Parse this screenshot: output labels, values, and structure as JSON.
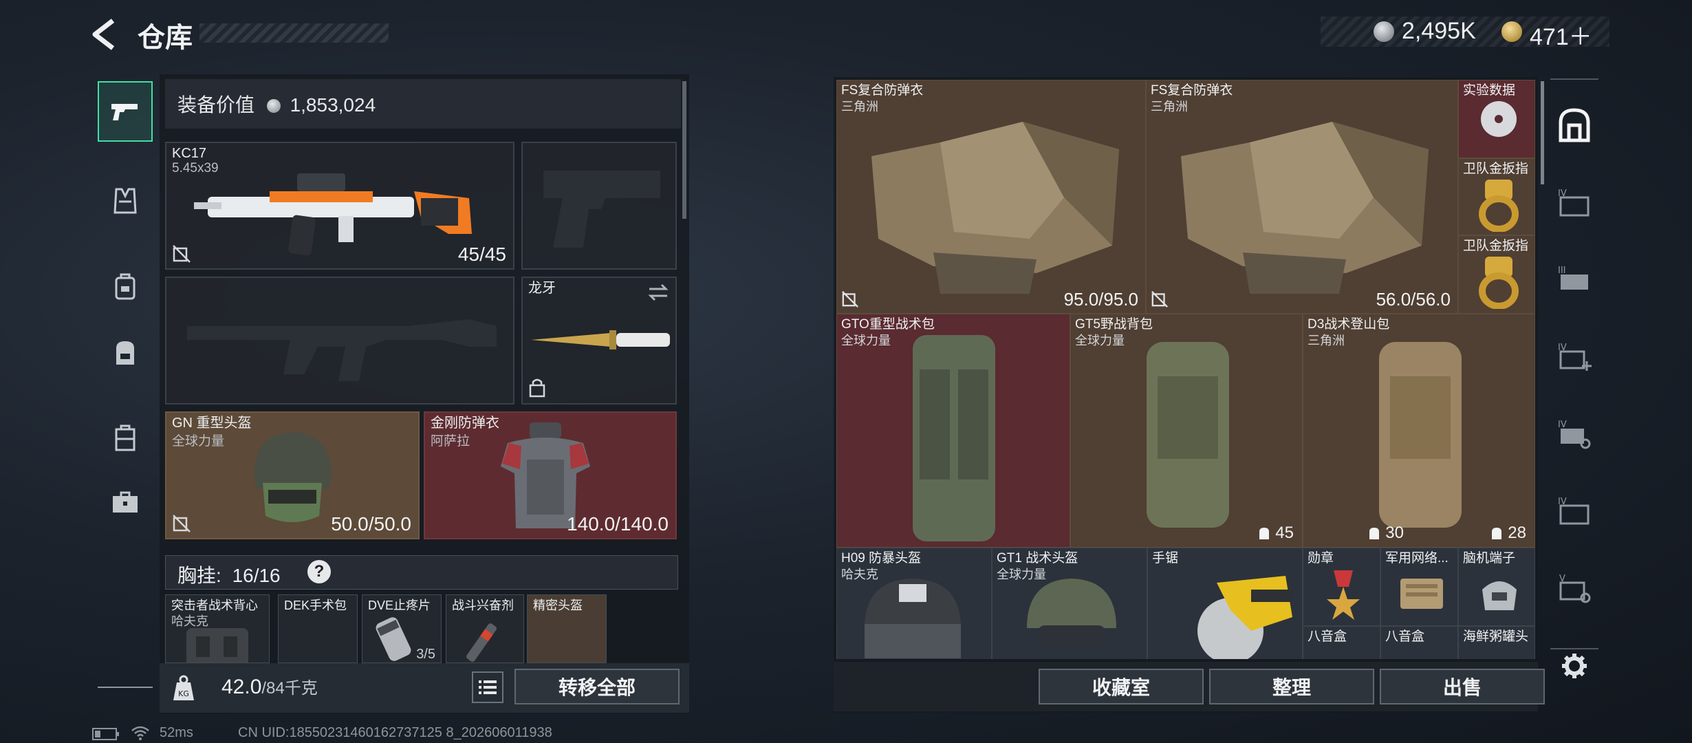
{
  "header": {
    "title": "仓库",
    "silver_amount": "2,495K",
    "gold_amount": "471＋"
  },
  "left_rail": {
    "items": [
      {
        "icon": "pistol-icon",
        "active": true
      },
      {
        "icon": "vest-icon",
        "active": false
      },
      {
        "icon": "backpack-small-icon",
        "active": false
      },
      {
        "icon": "backpack-icon",
        "active": false
      },
      {
        "icon": "case-icon",
        "active": false
      },
      {
        "icon": "briefcase-icon",
        "active": false
      }
    ]
  },
  "equipment": {
    "value_label": "装备价值",
    "value": "1,853,024",
    "primary_weapon": {
      "name": "KC17",
      "caliber": "5.45x39",
      "ammo": "45/45"
    },
    "knife": {
      "name": "龙牙"
    },
    "helmet": {
      "name": "GN 重型头盔",
      "map": "全球力量",
      "durability": "50.0/50.0"
    },
    "armor": {
      "name": "金刚防弹衣",
      "map": "阿萨拉",
      "durability": "140.0/140.0"
    },
    "chest_rig": {
      "label": "胸挂:",
      "capacity": "16/16",
      "help": "?"
    },
    "rig_items": [
      {
        "name": "突击者战术背心",
        "sub": "哈夫克"
      },
      {
        "name": "DEK手术包",
        "sub": ""
      },
      {
        "name": "DVE止疼片",
        "sub": "",
        "count": "3/5"
      },
      {
        "name": "战斗兴奋剂",
        "sub": ""
      },
      {
        "name": "精密头盔",
        "sub": ""
      }
    ],
    "weight_current": "42.0",
    "weight_max": "/84千克",
    "transfer_all": "转移全部"
  },
  "stash": {
    "items": [
      {
        "name": "FS复合防弹衣",
        "sub": "三角洲",
        "value": "95.0/95.0"
      },
      {
        "name": "FS复合防弹衣",
        "sub": "三角洲",
        "value": "56.0/56.0"
      },
      {
        "name": "实验数据",
        "sub": ""
      },
      {
        "name": "卫队金扳指",
        "sub": ""
      },
      {
        "name": "卫队金扳指",
        "sub": ""
      },
      {
        "name": "GTO重型战术包",
        "sub": "全球力量",
        "capacity": ""
      },
      {
        "name": "GT5野战背包",
        "sub": "全球力量",
        "capacity": "45"
      },
      {
        "name": "D3战术登山包",
        "sub": "三角洲",
        "capacity": "30"
      },
      {
        "name": "",
        "sub": "",
        "capacity": "28"
      },
      {
        "name": "H09 防暴头盔",
        "sub": "哈夫克"
      },
      {
        "name": "GT1 战术头盔",
        "sub": "全球力量"
      },
      {
        "name": "手锯",
        "sub": ""
      },
      {
        "name": "勋章",
        "sub": ""
      },
      {
        "name": "军用网络...",
        "sub": ""
      },
      {
        "name": "脑机端子",
        "sub": ""
      },
      {
        "name": "八音盒",
        "sub": ""
      },
      {
        "name": "八音盒",
        "sub": ""
      },
      {
        "name": "海鲜粥罐头",
        "sub": ""
      }
    ],
    "buttons": {
      "vault": "收藏室",
      "sort": "整理",
      "sell": "出售"
    }
  },
  "right_rail": {
    "items": [
      "stash-icon",
      "case-iv-icon",
      "case-iii-icon",
      "case-iv-plus-icon",
      "case-iv-gear-icon",
      "case-iv-folder-icon",
      "case-v-icon"
    ],
    "settings": "gear-icon"
  },
  "status_bar": {
    "ping": "52ms",
    "uid": "CN UID:18550231460162737125 8_202606011938"
  },
  "colors": {
    "accent": "#3fe0a2",
    "brown_slot": "#5d4a38",
    "red_slot": "#5e2c30"
  }
}
